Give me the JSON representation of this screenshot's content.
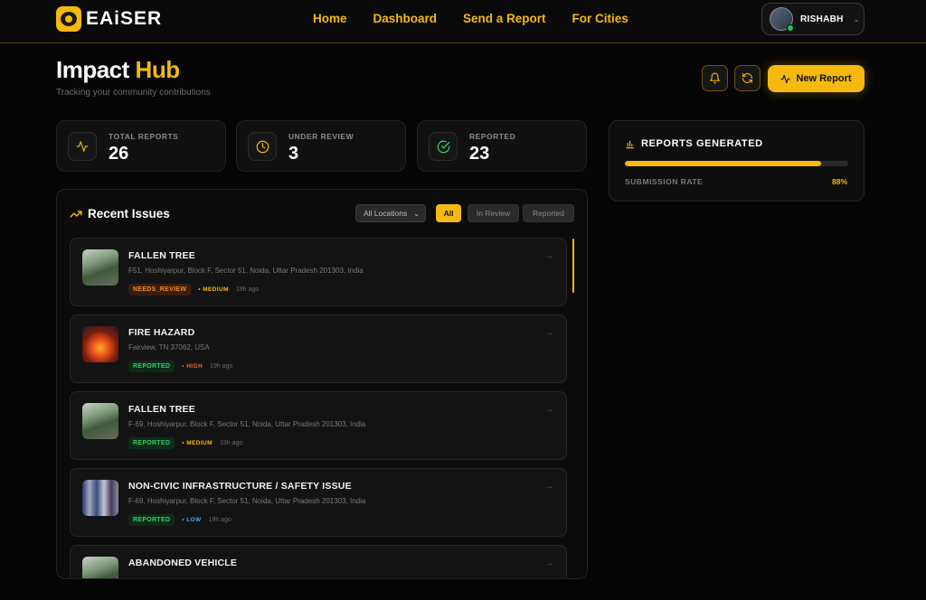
{
  "nav": {
    "brand": "EAiSER",
    "links": [
      "Home",
      "Dashboard",
      "Send a Report",
      "For Cities"
    ],
    "user": "RISHABH"
  },
  "header": {
    "title_main": "Impact",
    "title_accent": "Hub",
    "subtitle": "Tracking your community contributions",
    "new_report_label": "New Report"
  },
  "stats": [
    {
      "label": "TOTAL REPORTS",
      "value": "26",
      "icon": "activity-icon",
      "color": "#f5b90f"
    },
    {
      "label": "UNDER REVIEW",
      "value": "3",
      "icon": "clock-icon",
      "color": "#f5b90f"
    },
    {
      "label": "REPORTED",
      "value": "23",
      "icon": "check-circle-icon",
      "color": "#2fd067"
    }
  ],
  "reports_generated": {
    "title": "REPORTS GENERATED",
    "label": "SUBMISSION RATE",
    "percent_text": "88%",
    "percent": 88
  },
  "recent": {
    "title": "Recent Issues",
    "location_select": "All Locations",
    "filters": [
      "All",
      "In Review",
      "Reported"
    ],
    "active_filter": "All",
    "items": [
      {
        "title": "FALLEN TREE",
        "address": "F51, Hoshiyarpur, Block F, Sector 51, Noida, Uttar Pradesh 201303, India",
        "status": "NEEDS_REVIEW",
        "priority": "MEDIUM",
        "time": "19h ago",
        "thumb": "tree"
      },
      {
        "title": "FIRE HAZARD",
        "address": "Fairview, TN 37062, USA",
        "status": "REPORTED",
        "priority": "HIGH",
        "time": "19h ago",
        "thumb": "fire"
      },
      {
        "title": "FALLEN TREE",
        "address": "F-69, Hoshiyarpur, Block F, Sector 51, Noida, Uttar Pradesh 201303, India",
        "status": "REPORTED",
        "priority": "MEDIUM",
        "time": "19h ago",
        "thumb": "tree"
      },
      {
        "title": "NON-CIVIC INFRASTRUCTURE / SAFETY ISSUE",
        "address": "F-69, Hoshiyarpur, Block F, Sector 51, Noida, Uttar Pradesh 201303, India",
        "status": "REPORTED",
        "priority": "LOW",
        "time": "19h ago",
        "thumb": "people"
      },
      {
        "title": "ABANDONED VEHICLE",
        "address": "",
        "status": "",
        "priority": "",
        "time": "",
        "thumb": "tree"
      }
    ]
  },
  "colors": {
    "accent": "#f5b90f",
    "priority_medium": "#f5b90f",
    "priority_high": "#f06a2c",
    "priority_low": "#4ca3ff",
    "reported_green": "#2fd067",
    "review_orange": "#f08a2c"
  }
}
